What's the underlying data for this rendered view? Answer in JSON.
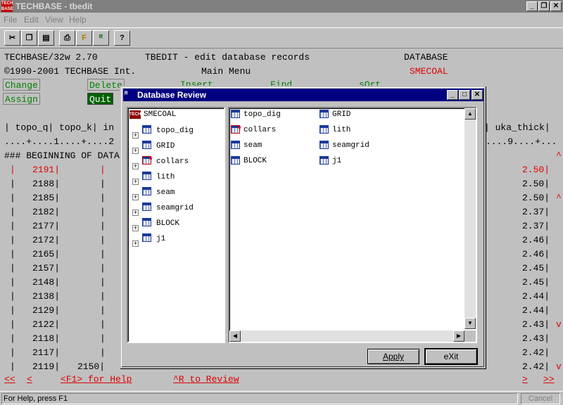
{
  "window": {
    "title": "TECHBASE - tbedit",
    "icon_label": "TECH BASE"
  },
  "menu": [
    "File",
    "Edit",
    "View",
    "Help"
  ],
  "toolbar_icons": [
    "cut-icon",
    "copy-icon",
    "paste-icon",
    "print-icon",
    "edit-icon",
    "review-icon",
    "help-icon"
  ],
  "toolbar_glyphs": [
    "✂",
    "❐",
    "▤",
    "⎙",
    "F",
    "ᴿ",
    "?"
  ],
  "caption_glyphs": {
    "minimize": "_",
    "restore": "❐",
    "close": "✕"
  },
  "header": {
    "line1_left": "TECHBASE/32w 2.70",
    "line1_mid": "TBEDIT - edit database records",
    "line1_right": "DATABASE",
    "line2_left": "©1990-2001 TECHBASE Int.",
    "line2_mid": "Main Menu",
    "line2_right": "SMECOAL",
    "change": "Change",
    "delete": "Delete",
    "insert": "Insert",
    "find": "Find",
    "sort": "sOrt",
    "assign": "Assign",
    "quit": "Quit"
  },
  "grid": {
    "columns_left": "| topo_q| topo_k| in",
    "columns_right": "| uka_thick|",
    "ruler_left": "....+....1....+....2",
    "ruler_right": "....9....+...",
    "beginning": "### BEGINNING OF DATA",
    "rows": [
      {
        "left": "2191|",
        "mid": "|",
        "right": "2.50|",
        "highlight": true
      },
      {
        "left": "2188|",
        "mid": "|",
        "right": "2.50|",
        "highlight": false
      },
      {
        "left": "2185|",
        "mid": "|",
        "right": "2.50|",
        "highlight": false
      },
      {
        "left": "2182|",
        "mid": "|",
        "right": "2.37|",
        "highlight": false
      },
      {
        "left": "2177|",
        "mid": "|",
        "right": "2.37|",
        "highlight": false
      },
      {
        "left": "2172|",
        "mid": "|",
        "right": "2.46|",
        "highlight": false
      },
      {
        "left": "2165|",
        "mid": "|",
        "right": "2.46|",
        "highlight": false
      },
      {
        "left": "2157|",
        "mid": "|",
        "right": "2.45|",
        "highlight": false
      },
      {
        "left": "2148|",
        "mid": "|",
        "right": "2.45|",
        "highlight": false
      },
      {
        "left": "2138|",
        "mid": "|",
        "right": "2.44|",
        "highlight": false
      },
      {
        "left": "2129|",
        "mid": "|",
        "right": "2.44|",
        "highlight": false
      },
      {
        "left": "2122|",
        "mid": "|",
        "right": "2.43|",
        "highlight": false
      },
      {
        "left": "2118|",
        "mid": "|",
        "right": "2.43|",
        "highlight": false
      },
      {
        "left": "2117|",
        "mid": "|",
        "right": "2.42|",
        "highlight": false
      },
      {
        "left": "2119|",
        "mid": "2150|",
        "right": "2.42|",
        "highlight": false
      }
    ],
    "side_marks": [
      "^",
      "^",
      "v"
    ]
  },
  "footer_nav": {
    "first": "<<",
    "prev": "<",
    "help": "<F1> for Help",
    "review": "^R to Review",
    "next": ">",
    "last": ">>"
  },
  "dialog": {
    "title": "Database Review",
    "tree_root": "SMECOAL",
    "tree_items": [
      {
        "name": "topo_dig",
        "starred": false
      },
      {
        "name": "GRID",
        "starred": false
      },
      {
        "name": "collars",
        "starred": true
      },
      {
        "name": "lith",
        "starred": false
      },
      {
        "name": "seam",
        "starred": false
      },
      {
        "name": "seamgrid",
        "starred": false
      },
      {
        "name": "BLOCK",
        "starred": false
      },
      {
        "name": "j1",
        "starred": false
      }
    ],
    "files_col1": [
      {
        "name": "topo_dig",
        "starred": false
      },
      {
        "name": "collars",
        "starred": true
      },
      {
        "name": "seam",
        "starred": false
      },
      {
        "name": "BLOCK",
        "starred": false
      }
    ],
    "files_col2": [
      {
        "name": "GRID",
        "starred": false
      },
      {
        "name": "lith",
        "starred": false
      },
      {
        "name": "seamgrid",
        "starred": false
      },
      {
        "name": "j1",
        "starred": false
      }
    ],
    "apply": "Apply",
    "exit": "eXit"
  },
  "status": {
    "text": "For Help, press F1",
    "cancel": "Cancel"
  }
}
